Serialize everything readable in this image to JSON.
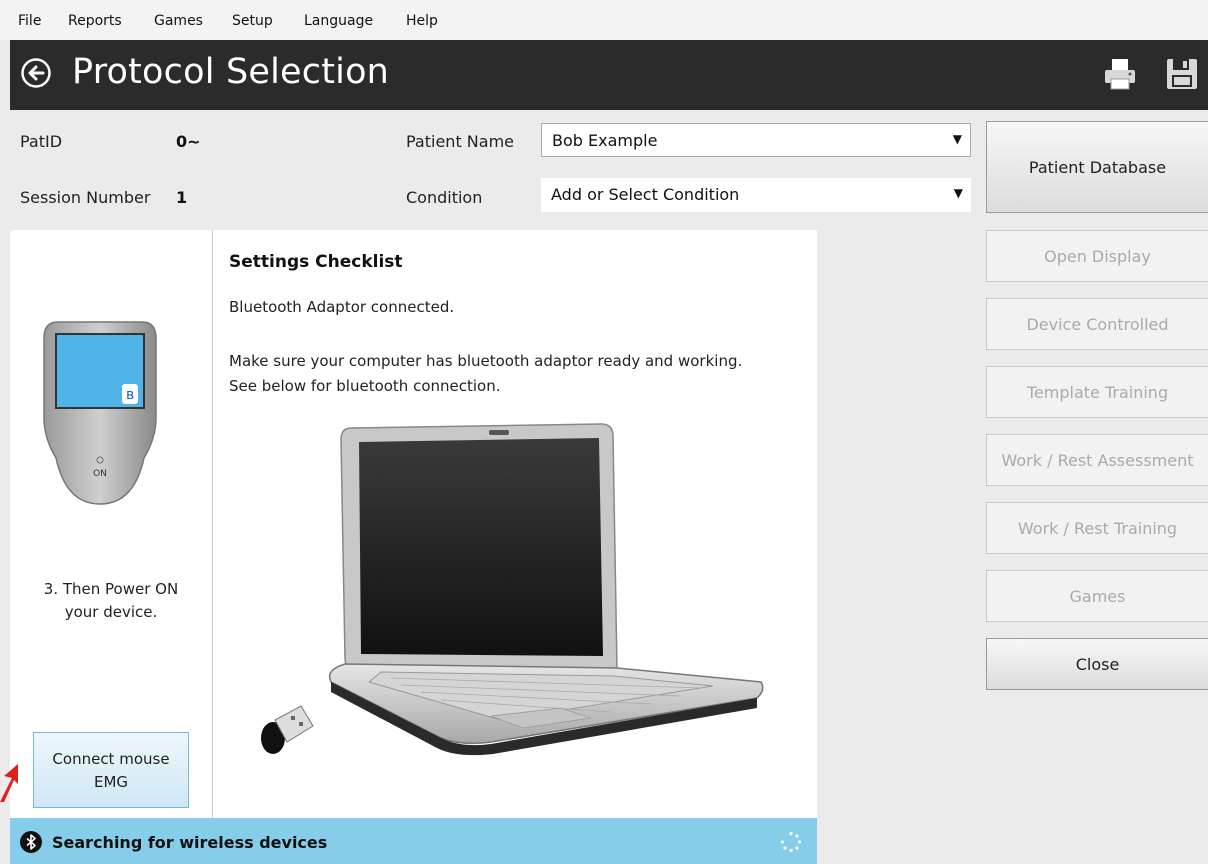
{
  "menu": [
    "File",
    "Reports",
    "Games",
    "Setup",
    "Language",
    "Help"
  ],
  "header": {
    "title": "Protocol Selection"
  },
  "patient": {
    "patid_label": "PatID",
    "patid_value": "0~",
    "session_label": "Session Number",
    "session_value": "1",
    "name_label": "Patient Name",
    "name_value": "Bob Example",
    "condition_label": "Condition",
    "condition_value": "Add or Select Condition"
  },
  "checklist": {
    "title": "Settings Checklist",
    "line1": "Bluetooth Adaptor connected.",
    "line2": "Make sure your computer has bluetooth adaptor ready and working.",
    "line3": "See below for bluetooth connection."
  },
  "device": {
    "on_label": "ON",
    "instruction_line1": "3. Then Power ON",
    "instruction_line2": "your device.",
    "connect_line1": "Connect mouse",
    "connect_line2": "EMG"
  },
  "status": {
    "text": "Searching for wireless devices"
  },
  "sidebar": {
    "patient_database": "Patient Database",
    "open_display": "Open Display",
    "device_controlled": "Device Controlled",
    "template_training": "Template Training",
    "work_rest_assessment": "Work / Rest Assessment",
    "work_rest_training": "Work / Rest Training",
    "games": "Games",
    "close": "Close"
  },
  "colors": {
    "accent": "#86cde9",
    "titlebar": "#2b2b2b",
    "annotation_arrow": "#e02020"
  }
}
